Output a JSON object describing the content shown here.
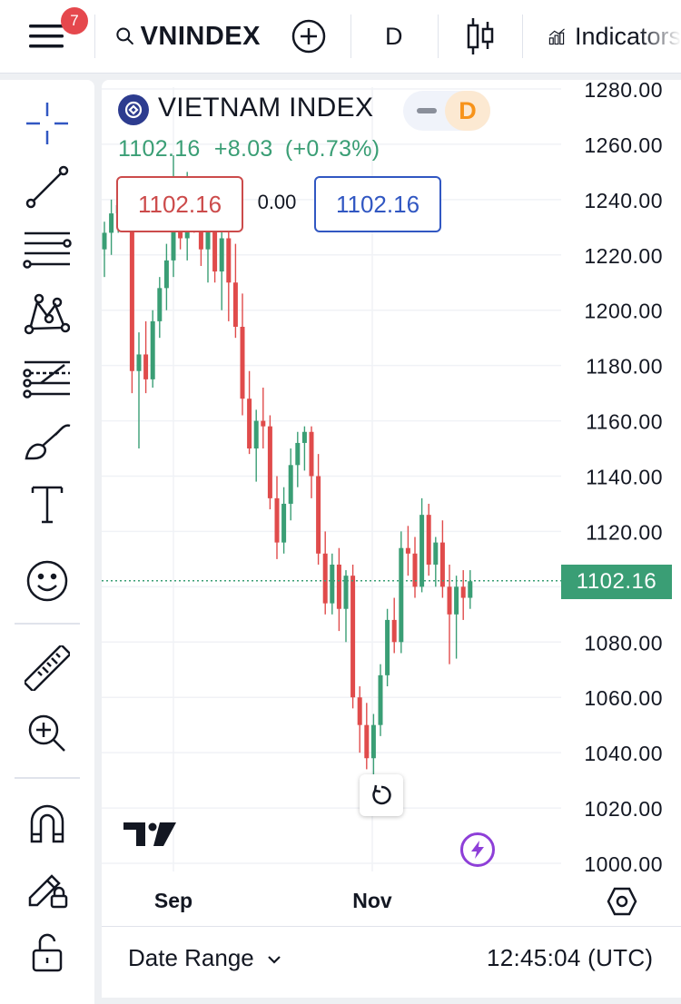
{
  "header": {
    "notification_count": "7",
    "symbol": "VNINDEX",
    "interval": "D",
    "indicators_label": "Indicators"
  },
  "legend": {
    "title": "VIETNAM INDEX",
    "interval_badge": "D",
    "last": "1102.16",
    "change": "+8.03",
    "change_pct": "(+0.73%)",
    "sell_price": "1102.16",
    "spread": "0.00",
    "buy_price": "1102.16"
  },
  "price_axis": {
    "ticks": [
      "1280.00",
      "1260.00",
      "1240.00",
      "1220.00",
      "1200.00",
      "1180.00",
      "1160.00",
      "1140.00",
      "1120.00",
      "1100.00",
      "1080.00",
      "1060.00",
      "1040.00",
      "1020.00",
      "1000.00"
    ],
    "current_price_label": "1102.16"
  },
  "time_axis": {
    "labels": [
      "Sep",
      "Nov"
    ]
  },
  "footer": {
    "date_range_label": "Date Range",
    "clock": "12:45:04 (UTC)"
  },
  "colors": {
    "up": "#3a9e75",
    "down": "#e04b4b",
    "accent": "#3157c2"
  },
  "chart_data": {
    "type": "candlestick",
    "ylim": [
      1000,
      1280
    ],
    "last_price": 1102.16,
    "x_tick_labels": [
      "Sep",
      "Nov"
    ],
    "series": [
      {
        "values": [
          [
            1222,
            1232,
            1212,
            1228
          ],
          [
            1228,
            1240,
            1220,
            1235
          ],
          [
            1235,
            1246,
            1228,
            1238
          ],
          [
            1238,
            1248,
            1232,
            1236
          ],
          [
            1236,
            1244,
            1170,
            1178
          ],
          [
            1178,
            1192,
            1150,
            1184
          ],
          [
            1184,
            1196,
            1170,
            1175
          ],
          [
            1175,
            1200,
            1172,
            1196
          ],
          [
            1196,
            1212,
            1190,
            1208
          ],
          [
            1208,
            1224,
            1200,
            1218
          ],
          [
            1218,
            1256,
            1212,
            1236
          ],
          [
            1236,
            1242,
            1222,
            1226
          ],
          [
            1226,
            1250,
            1218,
            1242
          ],
          [
            1242,
            1248,
            1228,
            1232
          ],
          [
            1232,
            1244,
            1216,
            1222
          ],
          [
            1222,
            1240,
            1210,
            1234
          ],
          [
            1234,
            1242,
            1210,
            1214
          ],
          [
            1214,
            1230,
            1200,
            1226
          ],
          [
            1226,
            1232,
            1196,
            1210
          ],
          [
            1210,
            1224,
            1190,
            1194
          ],
          [
            1194,
            1206,
            1162,
            1168
          ],
          [
            1168,
            1178,
            1148,
            1150
          ],
          [
            1150,
            1164,
            1138,
            1160
          ],
          [
            1160,
            1172,
            1150,
            1158
          ],
          [
            1158,
            1162,
            1128,
            1132
          ],
          [
            1132,
            1140,
            1110,
            1116
          ],
          [
            1116,
            1136,
            1112,
            1130
          ],
          [
            1130,
            1150,
            1124,
            1144
          ],
          [
            1144,
            1156,
            1136,
            1152
          ],
          [
            1152,
            1158,
            1142,
            1156
          ],
          [
            1156,
            1158,
            1132,
            1140
          ],
          [
            1140,
            1148,
            1108,
            1112
          ],
          [
            1112,
            1120,
            1090,
            1094
          ],
          [
            1094,
            1112,
            1090,
            1108
          ],
          [
            1108,
            1114,
            1084,
            1092
          ],
          [
            1092,
            1106,
            1080,
            1104
          ],
          [
            1104,
            1108,
            1056,
            1060
          ],
          [
            1060,
            1064,
            1040,
            1050
          ],
          [
            1050,
            1058,
            1034,
            1038
          ],
          [
            1038,
            1054,
            1030,
            1050
          ],
          [
            1050,
            1072,
            1046,
            1068
          ],
          [
            1068,
            1092,
            1064,
            1088
          ],
          [
            1088,
            1096,
            1076,
            1080
          ],
          [
            1080,
            1120,
            1076,
            1114
          ],
          [
            1114,
            1122,
            1104,
            1112
          ],
          [
            1112,
            1118,
            1096,
            1100
          ],
          [
            1100,
            1132,
            1098,
            1126
          ],
          [
            1126,
            1130,
            1104,
            1108
          ],
          [
            1108,
            1118,
            1100,
            1116
          ],
          [
            1116,
            1124,
            1096,
            1100
          ],
          [
            1100,
            1108,
            1072,
            1090
          ],
          [
            1090,
            1104,
            1074,
            1100
          ],
          [
            1100,
            1106,
            1088,
            1096
          ],
          [
            1096,
            1106,
            1092,
            1102
          ]
        ]
      }
    ]
  }
}
